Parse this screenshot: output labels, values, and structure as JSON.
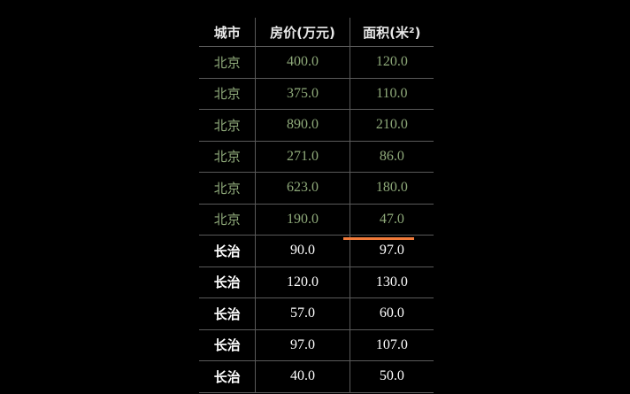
{
  "table": {
    "headers": [
      "城市",
      "房价(万元)",
      "面积(米²)"
    ],
    "rows": [
      {
        "city": "北京",
        "price": "400.0",
        "area": "120.0",
        "group": "a"
      },
      {
        "city": "北京",
        "price": "375.0",
        "area": "110.0",
        "group": "a"
      },
      {
        "city": "北京",
        "price": "890.0",
        "area": "210.0",
        "group": "a"
      },
      {
        "city": "北京",
        "price": "271.0",
        "area": "86.0",
        "group": "a"
      },
      {
        "city": "北京",
        "price": "623.0",
        "area": "180.0",
        "group": "a"
      },
      {
        "city": "北京",
        "price": "190.0",
        "area": "47.0",
        "group": "a"
      },
      {
        "city": "长治",
        "price": "90.0",
        "area": "97.0",
        "group": "b"
      },
      {
        "city": "长治",
        "price": "120.0",
        "area": "130.0",
        "group": "b"
      },
      {
        "city": "长治",
        "price": "57.0",
        "area": "60.0",
        "group": "b"
      },
      {
        "city": "长治",
        "price": "97.0",
        "area": "107.0",
        "group": "b"
      },
      {
        "city": "长治",
        "price": "40.0",
        "area": "50.0",
        "group": "b"
      }
    ]
  },
  "colors": {
    "background": "#000000",
    "group_a_text": "#8faa7a",
    "group_b_text": "#ffffff",
    "annotation": "#f07a3a"
  }
}
